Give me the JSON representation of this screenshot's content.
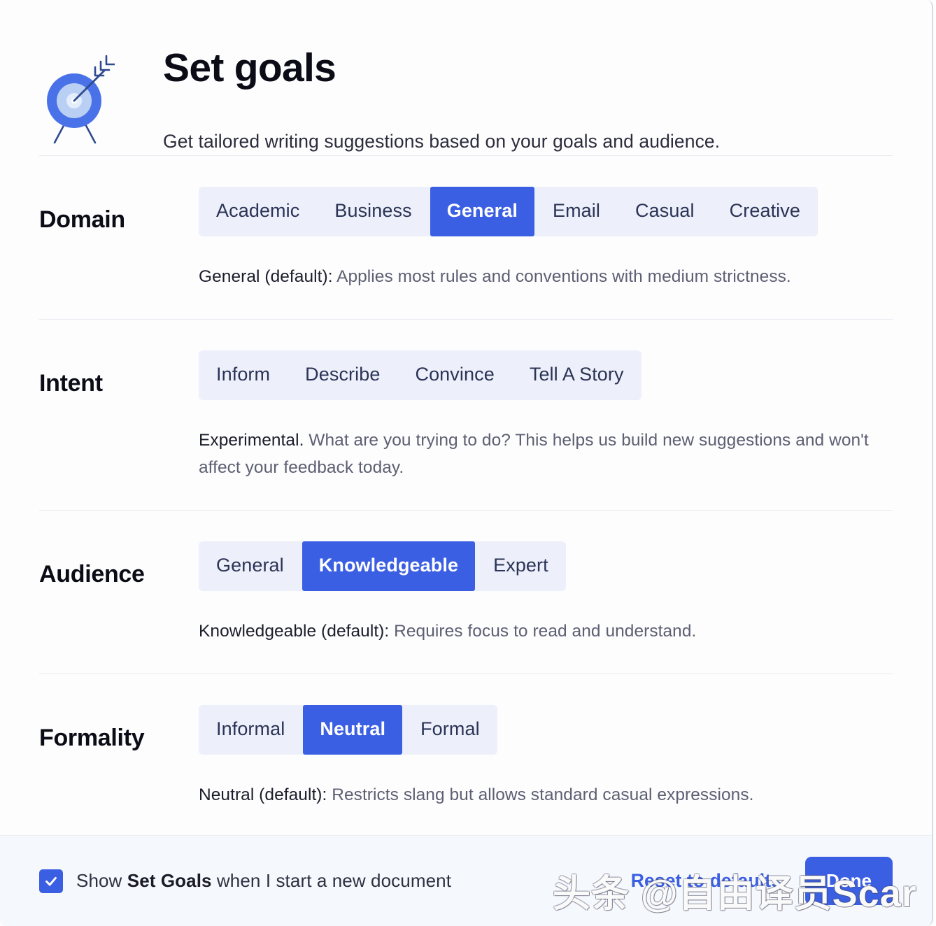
{
  "header": {
    "icon_name": "target-with-arrow-icon",
    "title": "Set goals",
    "subtitle": "Get tailored writing suggestions based on your goals and audience."
  },
  "colors": {
    "accent": "#3b5fe2",
    "chip_background": "#edf0fa",
    "chip_text": "#2b3356",
    "footer_background": "#f5f8fd",
    "page_background": "#fdfdfe",
    "divider": "#e9eaf0",
    "description_text": "#5d5f72"
  },
  "sections": [
    {
      "label": "Domain",
      "options": [
        {
          "label": "Academic",
          "selected": false
        },
        {
          "label": "Business",
          "selected": false
        },
        {
          "label": "General",
          "selected": true
        },
        {
          "label": "Email",
          "selected": false
        },
        {
          "label": "Casual",
          "selected": false
        },
        {
          "label": "Creative",
          "selected": false
        }
      ],
      "description_lead": "General (default):",
      "description_rest": " Applies most rules and conventions with medium strictness."
    },
    {
      "label": "Intent",
      "options": [
        {
          "label": "Inform",
          "selected": false
        },
        {
          "label": "Describe",
          "selected": false
        },
        {
          "label": "Convince",
          "selected": false
        },
        {
          "label": "Tell A Story",
          "selected": false
        }
      ],
      "description_lead": "Experimental.",
      "description_rest": " What are you trying to do? This helps us build new suggestions and won't affect your feedback today."
    },
    {
      "label": "Audience",
      "options": [
        {
          "label": "General",
          "selected": false
        },
        {
          "label": "Knowledgeable",
          "selected": true
        },
        {
          "label": "Expert",
          "selected": false
        }
      ],
      "description_lead": "Knowledgeable (default):",
      "description_rest": " Requires focus to read and understand."
    },
    {
      "label": "Formality",
      "options": [
        {
          "label": "Informal",
          "selected": false
        },
        {
          "label": "Neutral",
          "selected": true
        },
        {
          "label": "Formal",
          "selected": false
        }
      ],
      "description_lead": "Neutral (default):",
      "description_rest": " Restricts slang but allows standard casual expressions."
    }
  ],
  "footer": {
    "checkbox_checked": true,
    "checkbox_icon": "checkmark-icon",
    "checkbox_label_prefix": "Show ",
    "checkbox_label_strong": "Set Goals",
    "checkbox_label_suffix": " when I start a new document",
    "reset_label": "Reset to defaults",
    "done_label": "Done"
  },
  "watermark": {
    "text": "头条 @自由译员Scar"
  }
}
